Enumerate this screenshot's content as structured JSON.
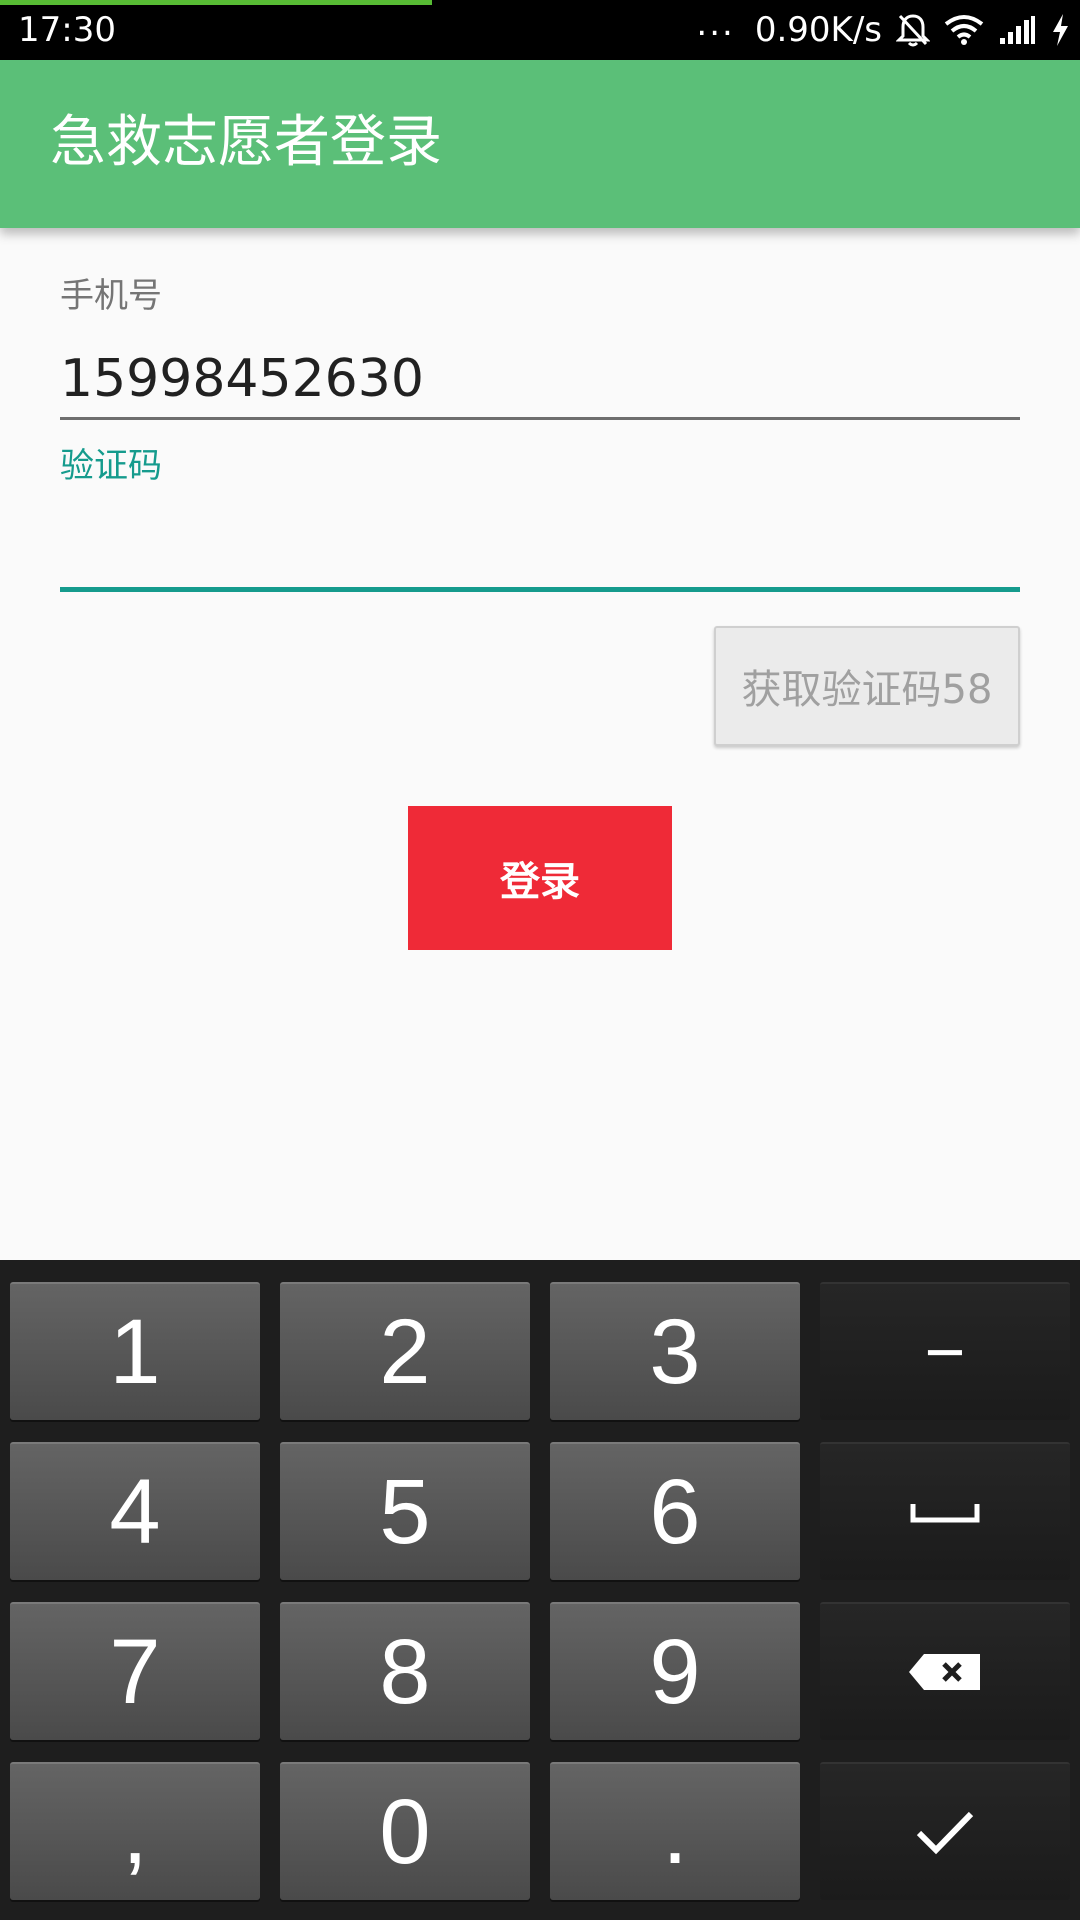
{
  "status_bar": {
    "time": "17:30",
    "dots": "...",
    "network_speed": "0.90K/s",
    "icons": [
      "bell-off-icon",
      "wifi-icon",
      "signal-icon",
      "charging-icon"
    ],
    "page_load_progress": 0.4
  },
  "app_bar": {
    "title": "急救志愿者登录",
    "color": "#5bbf78"
  },
  "form": {
    "phone_label": "手机号",
    "phone_value": "15998452630",
    "code_label": "验证码",
    "code_value": "",
    "get_code_button": "获取验证码58",
    "login_button": "登录",
    "accent_color": "#159b8d",
    "login_color": "#ef2a37"
  },
  "keyboard": {
    "keys": [
      "1",
      "2",
      "3",
      "−",
      "4",
      "5",
      "6",
      "space-icon",
      "7",
      "8",
      "9",
      "backspace-icon",
      ",",
      "0",
      ".",
      "check-icon"
    ]
  }
}
